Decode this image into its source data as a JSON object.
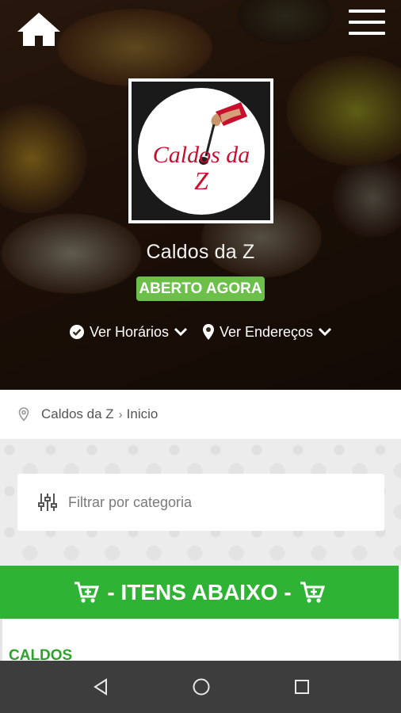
{
  "header": {
    "home_icon": "home-icon",
    "menu_icon": "hamburger-menu-icon"
  },
  "store": {
    "logo_text_line1": "Caldos da",
    "logo_text_line2": "Z",
    "name": "Caldos da Z",
    "status_badge": "ABERTO AGORA",
    "hours_link": "Ver Horários",
    "address_link": "Ver Endereços"
  },
  "breadcrumb": {
    "items": [
      "Caldos da Z",
      "Inicio"
    ],
    "separator": "›"
  },
  "filter": {
    "placeholder": "Filtrar por categoria"
  },
  "cart_banner": {
    "label": "- ITENS ABAIXO -"
  },
  "menu": {
    "section_title": "CALDOS"
  },
  "colors": {
    "accent_green": "#2fb334",
    "badge_green": "#6cc04a",
    "brand_red": "#c8102e",
    "nav_bar": "#3d3d3d"
  }
}
